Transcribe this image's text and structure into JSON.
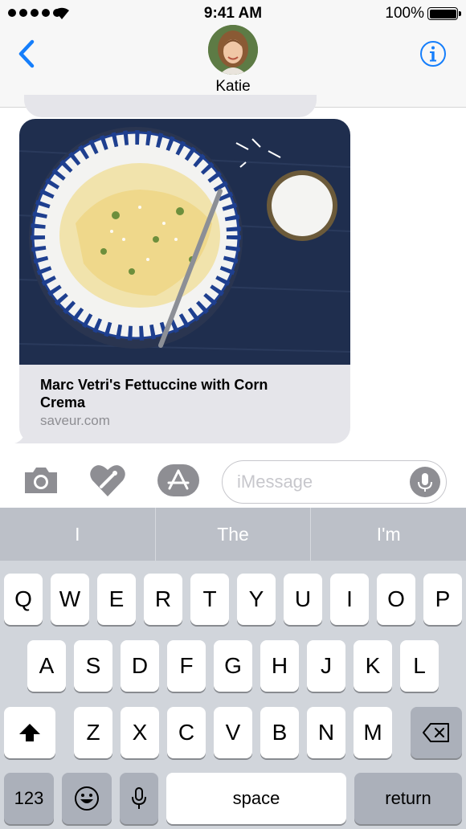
{
  "status_bar": {
    "time": "9:41 AM",
    "battery": "100%"
  },
  "header": {
    "contact_name": "Katie"
  },
  "message": {
    "link_title": "Marc Vetri's Fettuccine with Corn Crema",
    "link_domain": "saveur.com"
  },
  "input_bar": {
    "placeholder": "iMessage"
  },
  "keyboard": {
    "suggestions": [
      "I",
      "The",
      "I'm"
    ],
    "row1": [
      "Q",
      "W",
      "E",
      "R",
      "T",
      "Y",
      "U",
      "I",
      "O",
      "P"
    ],
    "row2": [
      "A",
      "S",
      "D",
      "F",
      "G",
      "H",
      "J",
      "K",
      "L"
    ],
    "row3": [
      "Z",
      "X",
      "C",
      "V",
      "B",
      "N",
      "M"
    ],
    "numbers_label": "123",
    "space_label": "space",
    "return_label": "return"
  },
  "colors": {
    "accent": "#157efb",
    "bubble": "#e5e5ea",
    "keyboard": "#d1d5db"
  },
  "icons": [
    "back-chevron-icon",
    "info-icon",
    "camera-icon",
    "digital-touch-icon",
    "app-store-icon",
    "microphone-icon",
    "shift-icon",
    "delete-icon",
    "emoji-icon"
  ]
}
